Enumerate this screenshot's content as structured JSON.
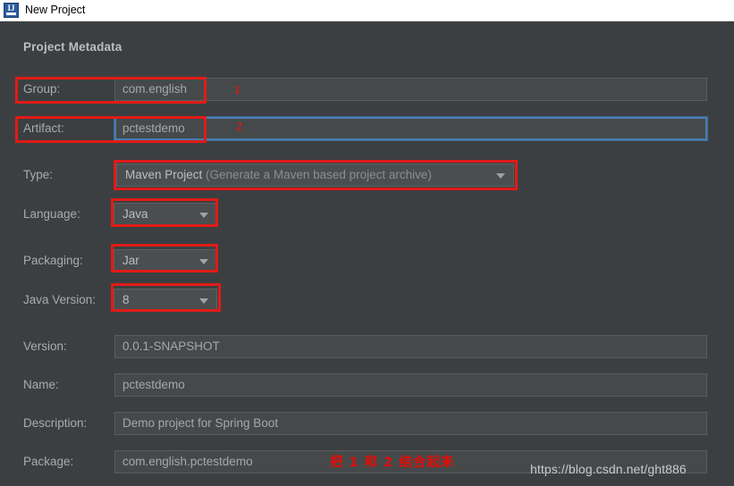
{
  "window": {
    "title": "New Project",
    "icon": "intellij-idea-icon",
    "icon_text": "IJ"
  },
  "dialog": {
    "section_title": "Project Metadata",
    "rows": [
      {
        "label": "Group:",
        "control": "text",
        "value": "com.english",
        "focused": false,
        "highlighted": true
      },
      {
        "label": "Artifact:",
        "control": "text",
        "value": "pctestdemo",
        "focused": true,
        "highlighted": true
      },
      {
        "label": "Type:",
        "control": "combo",
        "value": "Maven Project",
        "value_suffix": " (Generate a Maven based project archive)",
        "highlighted": true
      },
      {
        "label": "Language:",
        "control": "combo",
        "value": "Java",
        "highlighted": true
      },
      {
        "label": "Packaging:",
        "control": "combo",
        "value": "Jar",
        "highlighted": true
      },
      {
        "label": "Java Version:",
        "control": "combo",
        "value": "8",
        "highlighted": true
      },
      {
        "label": "Version:",
        "control": "text",
        "value": "0.0.1-SNAPSHOT",
        "focused": false,
        "highlighted": false
      },
      {
        "label": "Name:",
        "control": "text",
        "value": "pctestdemo",
        "focused": false,
        "highlighted": false
      },
      {
        "label": "Description:",
        "control": "text",
        "value": "Demo project for Spring Boot",
        "focused": false,
        "highlighted": false
      },
      {
        "label": "Package:",
        "control": "text",
        "value": "com.english.pctestdemo",
        "focused": false,
        "highlighted": false
      }
    ]
  },
  "annotations": {
    "marker_one": "1",
    "marker_two": "2",
    "note": "把 1 和 2 结合起来"
  },
  "watermark": {
    "url": "https://blog.csdn.net/ght886"
  },
  "colors": {
    "window_background": "#3c3f41",
    "field_background": "#45494a",
    "combo_background": "#4a4e50",
    "annotation_red": "#e01b17",
    "focus_blue": "#4a7cb0",
    "label_text": "#a9abad"
  }
}
